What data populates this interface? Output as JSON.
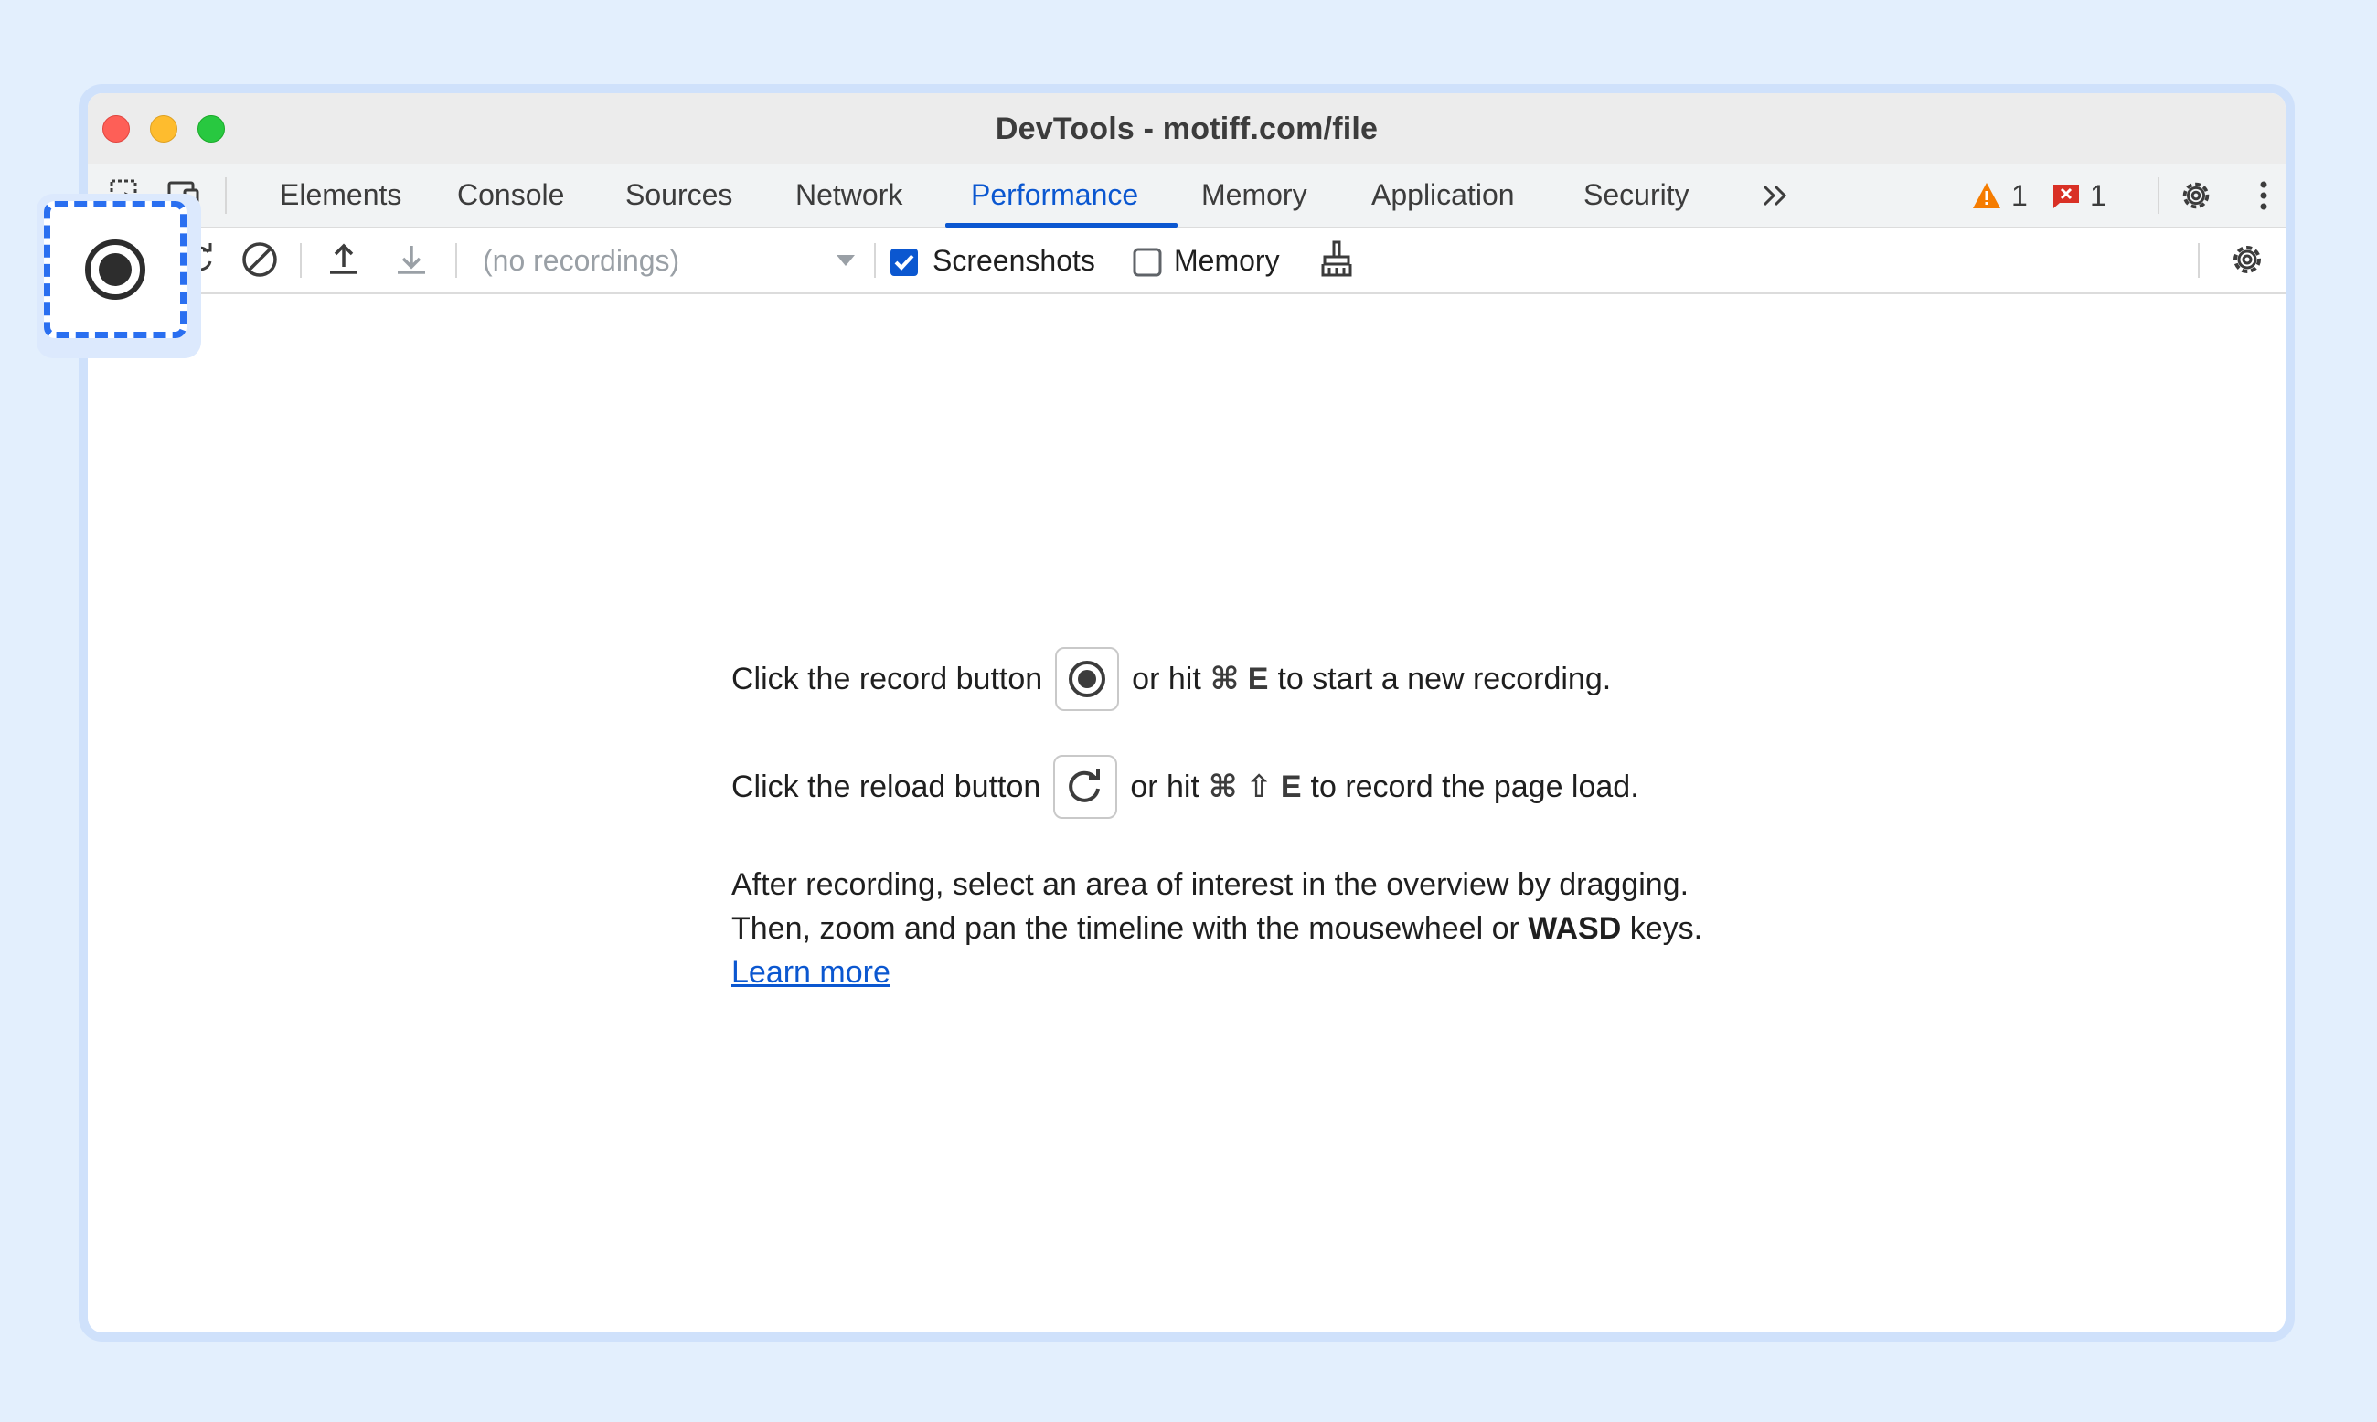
{
  "window": {
    "title": "DevTools - motiff.com/file"
  },
  "tabs": [
    {
      "label": "Elements",
      "active": false
    },
    {
      "label": "Console",
      "active": false
    },
    {
      "label": "Sources",
      "active": false
    },
    {
      "label": "Network",
      "active": false
    },
    {
      "label": "Performance",
      "active": true
    },
    {
      "label": "Memory",
      "active": false
    },
    {
      "label": "Application",
      "active": false
    },
    {
      "label": "Security",
      "active": false
    }
  ],
  "more_tabs_icon": "double-chevron-right-icon",
  "status": {
    "warnings_count": "1",
    "errors_count": "1"
  },
  "toolbar": {
    "recordings_select": "(no recordings)",
    "screenshots_label": "Screenshots",
    "screenshots_checked": true,
    "memory_label": "Memory",
    "memory_checked": false
  },
  "main": {
    "line1_prefix": "Click the record button",
    "line1_mid": "or hit",
    "line1_keys": "⌘ E",
    "line1_suffix": "to start a new recording.",
    "line2_prefix": "Click the reload button",
    "line2_mid": "or hit",
    "line2_keys": "⌘ ⇧ E",
    "line2_suffix": "to record the page load.",
    "para_line1": "After recording, select an area of interest in the overview by dragging.",
    "para_line2_prefix": "Then, zoom and pan the timeline with the mousewheel or",
    "para_line2_keys": "WASD",
    "para_line2_suffix": "keys.",
    "learn_more": "Learn more"
  },
  "colors": {
    "accent": "#0b57d0",
    "highlight_dash": "#2a6ff0",
    "background": "#e3effd",
    "warning": "#f57c00",
    "error": "#d93025"
  }
}
